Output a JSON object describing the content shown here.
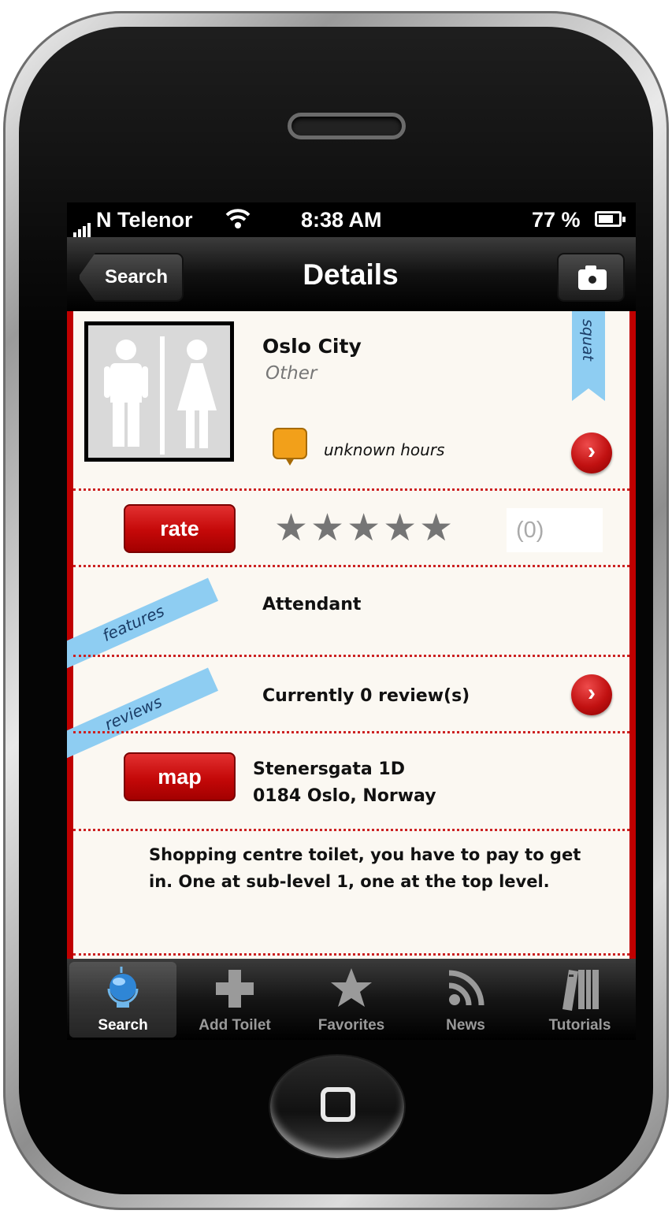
{
  "status_bar": {
    "carrier": "N Telenor",
    "time": "8:38 AM",
    "battery": "77 %"
  },
  "nav": {
    "back_label": "Search",
    "title": "Details"
  },
  "place": {
    "name": "Oslo City",
    "type": "Other",
    "hours": "unknown hours",
    "tag": "squat"
  },
  "rating": {
    "button_label": "rate",
    "stars": 0,
    "stars_max": 5,
    "count": "(0)"
  },
  "features": {
    "ribbon": "features",
    "text": "Attendant"
  },
  "reviews": {
    "ribbon": "reviews",
    "text": "Currently 0 review(s)"
  },
  "location": {
    "button_label": "map",
    "street": "Stenersgata 1D",
    "city": "0184 Oslo, Norway"
  },
  "description": "Shopping centre toilet, you have to pay to get in. One at sub-level 1, one at the top level.",
  "tab_bar": [
    {
      "label": "Search",
      "icon": "globe-icon",
      "active": true
    },
    {
      "label": "Add Toilet",
      "icon": "plus-icon",
      "active": false
    },
    {
      "label": "Favorites",
      "icon": "star-icon",
      "active": false
    },
    {
      "label": "News",
      "icon": "rss-icon",
      "active": false
    },
    {
      "label": "Tutorials",
      "icon": "books-icon",
      "active": false
    }
  ],
  "colors": {
    "accent_red": "#c00000",
    "ribbon_blue": "#8ecdf2",
    "hours_orange": "#f2a01a"
  }
}
